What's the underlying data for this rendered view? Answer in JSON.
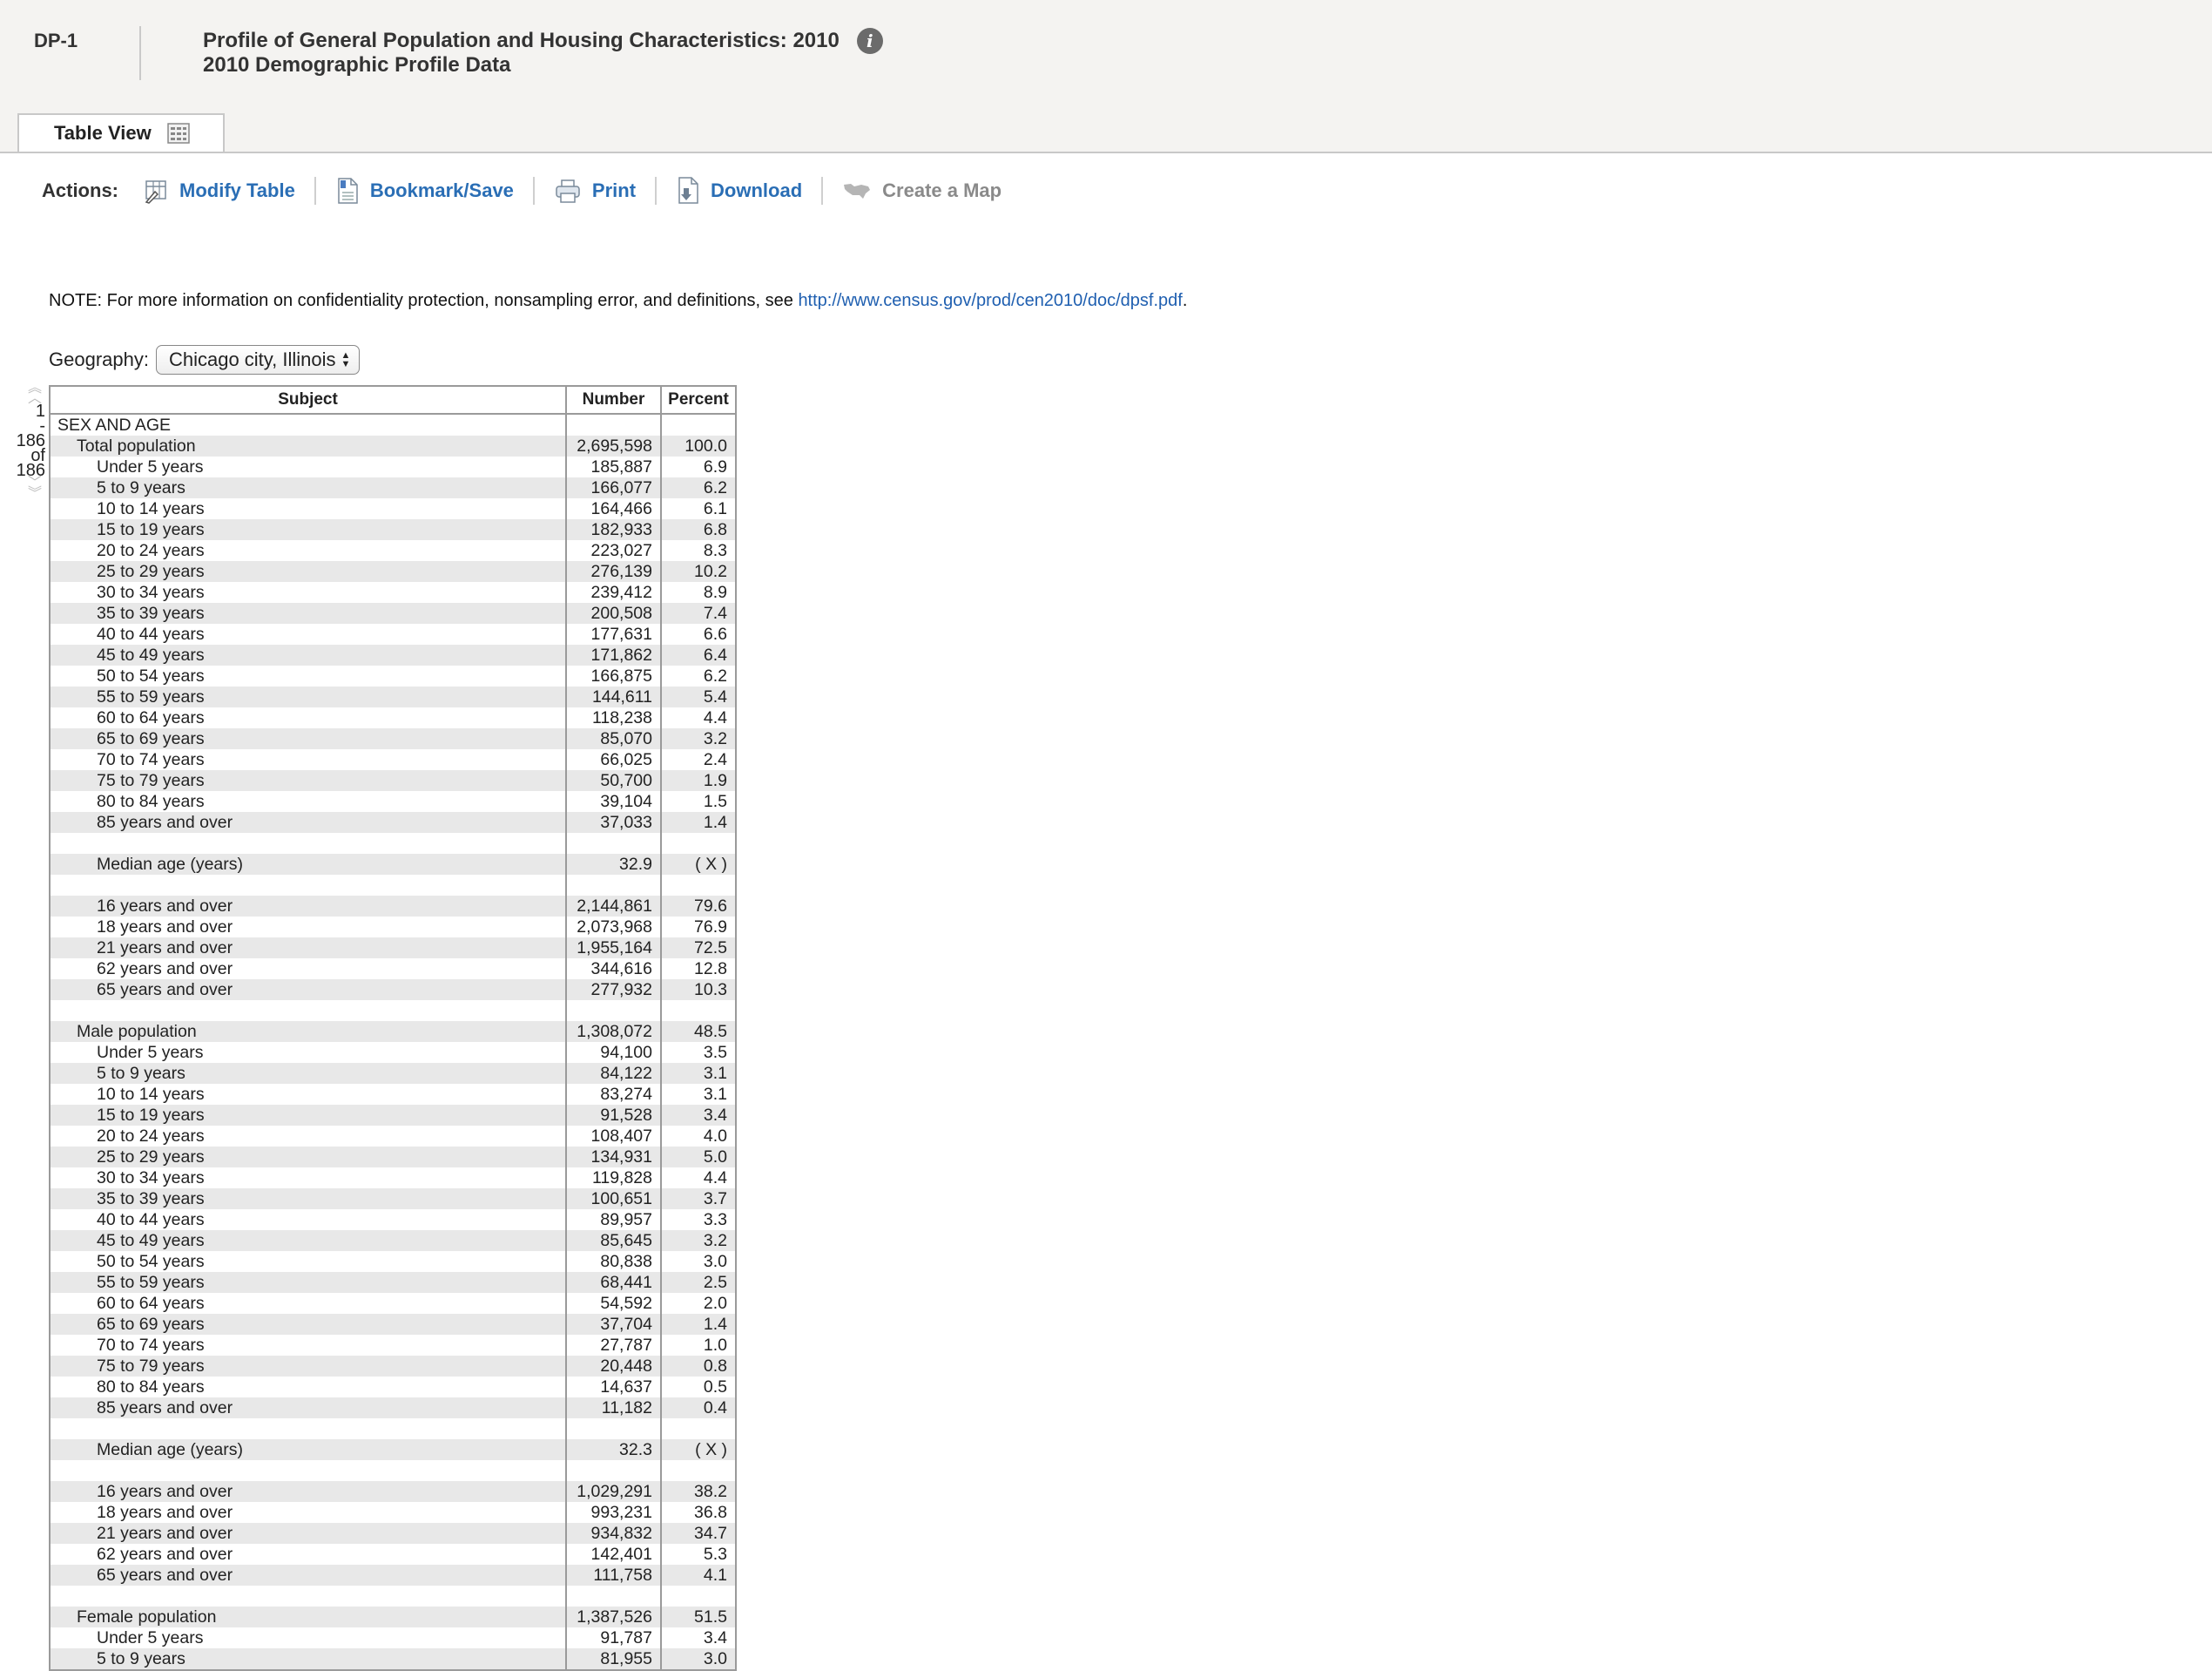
{
  "header": {
    "table_id": "DP-1",
    "title": "Profile of General Population and Housing Characteristics: 2010",
    "subtitle": "2010 Demographic Profile Data",
    "info_icon": "info-icon"
  },
  "tabs": [
    {
      "label": "Table View",
      "icon": "grid-icon",
      "active": true
    }
  ],
  "actions": {
    "label": "Actions:",
    "items": [
      {
        "label": "Modify Table",
        "icon": "modify-table-icon",
        "enabled": true
      },
      {
        "label": "Bookmark/Save",
        "icon": "bookmark-icon",
        "enabled": true
      },
      {
        "label": "Print",
        "icon": "print-icon",
        "enabled": true
      },
      {
        "label": "Download",
        "icon": "download-icon",
        "enabled": true
      },
      {
        "label": "Create a Map",
        "icon": "map-icon",
        "enabled": false
      }
    ]
  },
  "note": {
    "text": "NOTE: For more information on confidentiality protection, nonsampling error, and definitions, see ",
    "link": "http://www.census.gov/prod/cen2010/doc/dpsf.pdf",
    "suffix": "."
  },
  "geography": {
    "label": "Geography:",
    "selected": "Chicago city, Illinois"
  },
  "pager": {
    "start": "1",
    "dash": "-",
    "end": "186",
    "of": "of",
    "total": "186"
  },
  "table": {
    "headers": [
      "Subject",
      "Number",
      "Percent"
    ],
    "rows": [
      {
        "s": "SEX AND AGE",
        "n": "",
        "p": "",
        "i": 0
      },
      {
        "s": "Total population",
        "n": "2,695,598",
        "p": "100.0",
        "i": 1
      },
      {
        "s": "Under 5 years",
        "n": "185,887",
        "p": "6.9",
        "i": 2
      },
      {
        "s": "5 to 9 years",
        "n": "166,077",
        "p": "6.2",
        "i": 2
      },
      {
        "s": "10 to 14 years",
        "n": "164,466",
        "p": "6.1",
        "i": 2
      },
      {
        "s": "15 to 19 years",
        "n": "182,933",
        "p": "6.8",
        "i": 2
      },
      {
        "s": "20 to 24 years",
        "n": "223,027",
        "p": "8.3",
        "i": 2
      },
      {
        "s": "25 to 29 years",
        "n": "276,139",
        "p": "10.2",
        "i": 2
      },
      {
        "s": "30 to 34 years",
        "n": "239,412",
        "p": "8.9",
        "i": 2
      },
      {
        "s": "35 to 39 years",
        "n": "200,508",
        "p": "7.4",
        "i": 2
      },
      {
        "s": "40 to 44 years",
        "n": "177,631",
        "p": "6.6",
        "i": 2
      },
      {
        "s": "45 to 49 years",
        "n": "171,862",
        "p": "6.4",
        "i": 2
      },
      {
        "s": "50 to 54 years",
        "n": "166,875",
        "p": "6.2",
        "i": 2
      },
      {
        "s": "55 to 59 years",
        "n": "144,611",
        "p": "5.4",
        "i": 2
      },
      {
        "s": "60 to 64 years",
        "n": "118,238",
        "p": "4.4",
        "i": 2
      },
      {
        "s": "65 to 69 years",
        "n": "85,070",
        "p": "3.2",
        "i": 2
      },
      {
        "s": "70 to 74 years",
        "n": "66,025",
        "p": "2.4",
        "i": 2
      },
      {
        "s": "75 to 79 years",
        "n": "50,700",
        "p": "1.9",
        "i": 2
      },
      {
        "s": "80 to 84 years",
        "n": "39,104",
        "p": "1.5",
        "i": 2
      },
      {
        "s": "85 years and over",
        "n": "37,033",
        "p": "1.4",
        "i": 2
      },
      {
        "s": "",
        "n": "",
        "p": "",
        "i": 2
      },
      {
        "s": "Median age (years)",
        "n": "32.9",
        "p": "( X )",
        "i": 2
      },
      {
        "s": "",
        "n": "",
        "p": "",
        "i": 2
      },
      {
        "s": "16 years and over",
        "n": "2,144,861",
        "p": "79.6",
        "i": 2
      },
      {
        "s": "18 years and over",
        "n": "2,073,968",
        "p": "76.9",
        "i": 2
      },
      {
        "s": "21 years and over",
        "n": "1,955,164",
        "p": "72.5",
        "i": 2
      },
      {
        "s": "62 years and over",
        "n": "344,616",
        "p": "12.8",
        "i": 2
      },
      {
        "s": "65 years and over",
        "n": "277,932",
        "p": "10.3",
        "i": 2
      },
      {
        "s": "",
        "n": "",
        "p": "",
        "i": 2
      },
      {
        "s": "Male population",
        "n": "1,308,072",
        "p": "48.5",
        "i": 1
      },
      {
        "s": "Under 5 years",
        "n": "94,100",
        "p": "3.5",
        "i": 2
      },
      {
        "s": "5 to 9 years",
        "n": "84,122",
        "p": "3.1",
        "i": 2
      },
      {
        "s": "10 to 14 years",
        "n": "83,274",
        "p": "3.1",
        "i": 2
      },
      {
        "s": "15 to 19 years",
        "n": "91,528",
        "p": "3.4",
        "i": 2
      },
      {
        "s": "20 to 24 years",
        "n": "108,407",
        "p": "4.0",
        "i": 2
      },
      {
        "s": "25 to 29 years",
        "n": "134,931",
        "p": "5.0",
        "i": 2
      },
      {
        "s": "30 to 34 years",
        "n": "119,828",
        "p": "4.4",
        "i": 2
      },
      {
        "s": "35 to 39 years",
        "n": "100,651",
        "p": "3.7",
        "i": 2
      },
      {
        "s": "40 to 44 years",
        "n": "89,957",
        "p": "3.3",
        "i": 2
      },
      {
        "s": "45 to 49 years",
        "n": "85,645",
        "p": "3.2",
        "i": 2
      },
      {
        "s": "50 to 54 years",
        "n": "80,838",
        "p": "3.0",
        "i": 2
      },
      {
        "s": "55 to 59 years",
        "n": "68,441",
        "p": "2.5",
        "i": 2
      },
      {
        "s": "60 to 64 years",
        "n": "54,592",
        "p": "2.0",
        "i": 2
      },
      {
        "s": "65 to 69 years",
        "n": "37,704",
        "p": "1.4",
        "i": 2
      },
      {
        "s": "70 to 74 years",
        "n": "27,787",
        "p": "1.0",
        "i": 2
      },
      {
        "s": "75 to 79 years",
        "n": "20,448",
        "p": "0.8",
        "i": 2
      },
      {
        "s": "80 to 84 years",
        "n": "14,637",
        "p": "0.5",
        "i": 2
      },
      {
        "s": "85 years and over",
        "n": "11,182",
        "p": "0.4",
        "i": 2
      },
      {
        "s": "",
        "n": "",
        "p": "",
        "i": 2
      },
      {
        "s": "Median age (years)",
        "n": "32.3",
        "p": "( X )",
        "i": 2
      },
      {
        "s": "",
        "n": "",
        "p": "",
        "i": 2
      },
      {
        "s": "16 years and over",
        "n": "1,029,291",
        "p": "38.2",
        "i": 2
      },
      {
        "s": "18 years and over",
        "n": "993,231",
        "p": "36.8",
        "i": 2
      },
      {
        "s": "21 years and over",
        "n": "934,832",
        "p": "34.7",
        "i": 2
      },
      {
        "s": "62 years and over",
        "n": "142,401",
        "p": "5.3",
        "i": 2
      },
      {
        "s": "65 years and over",
        "n": "111,758",
        "p": "4.1",
        "i": 2
      },
      {
        "s": "",
        "n": "",
        "p": "",
        "i": 2
      },
      {
        "s": "Female population",
        "n": "1,387,526",
        "p": "51.5",
        "i": 1
      },
      {
        "s": "Under 5 years",
        "n": "91,787",
        "p": "3.4",
        "i": 2
      },
      {
        "s": "5 to 9 years",
        "n": "81,955",
        "p": "3.0",
        "i": 2
      }
    ]
  }
}
